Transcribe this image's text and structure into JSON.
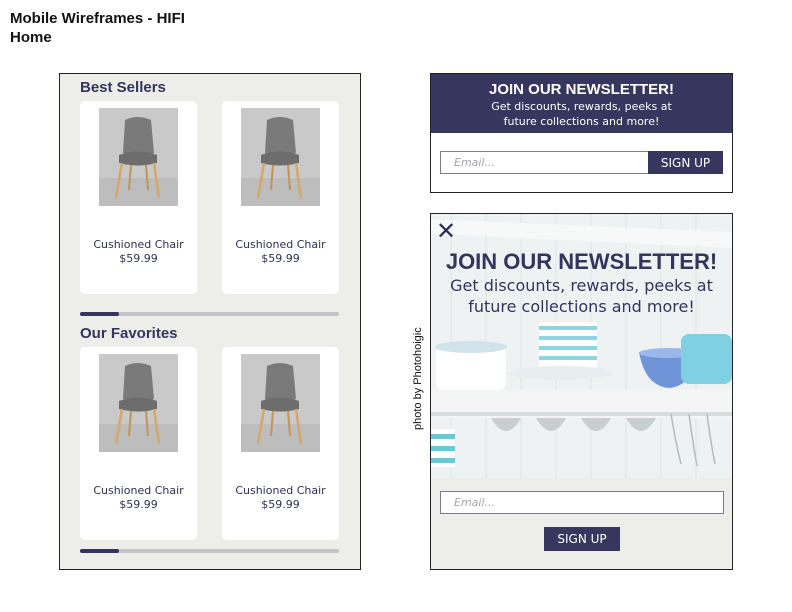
{
  "header": {
    "title_line1": "Mobile Wireframes - HIFI",
    "title_line2": "Home"
  },
  "home_screen": {
    "best_sellers": {
      "title": "Best Sellers",
      "products": [
        {
          "name": "Cushioned Chair",
          "price": "$59.99"
        },
        {
          "name": "Cushioned Chair",
          "price": "$59.99"
        }
      ],
      "scroll_progress": 0.15
    },
    "favorites": {
      "title": "Our Favorites",
      "products": [
        {
          "name": "Cushioned Chair",
          "price": "$59.99"
        },
        {
          "name": "Cushioned Chair",
          "price": "$59.99"
        }
      ],
      "scroll_progress": 0.15
    }
  },
  "newsletter_inline": {
    "heading": "JOIN OUR NEWSLETTER!",
    "subtext_line1": "Get discounts, rewards, peeks at",
    "subtext_line2": "future collections and more!",
    "email_placeholder": "Email...",
    "button_label": "SIGN UP"
  },
  "newsletter_modal": {
    "close_icon": "close-icon",
    "heading": "JOIN OUR NEWSLETTER!",
    "subtext_line1": "Get discounts, rewards, peeks at",
    "subtext_line2": "future collections and more!",
    "email_placeholder": "Email...",
    "button_label": "SIGN UP",
    "photo_credit": "photo by Photohoigic"
  },
  "colors": {
    "accent": "#36365f",
    "panel_bg": "#ededea",
    "card_bg": "#ffffff"
  }
}
